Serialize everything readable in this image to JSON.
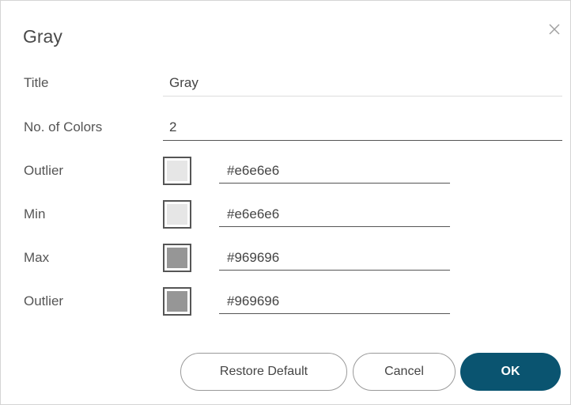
{
  "dialog": {
    "title": "Gray",
    "close_icon": "close-icon"
  },
  "fields": {
    "title_label": "Title",
    "title_value": "Gray",
    "num_colors_label": "No. of Colors",
    "num_colors_value": "2"
  },
  "colors": [
    {
      "label": "Outlier",
      "hex": "#e6e6e6",
      "swatch": "#e6e6e6"
    },
    {
      "label": "Min",
      "hex": "#e6e6e6",
      "swatch": "#e6e6e6"
    },
    {
      "label": "Max",
      "hex": "#969696",
      "swatch": "#969696"
    },
    {
      "label": "Outlier",
      "hex": "#969696",
      "swatch": "#969696"
    }
  ],
  "buttons": {
    "restore_label": "Restore Default",
    "cancel_label": "Cancel",
    "ok_label": "OK"
  },
  "theme": {
    "primary": "#0a5470"
  }
}
